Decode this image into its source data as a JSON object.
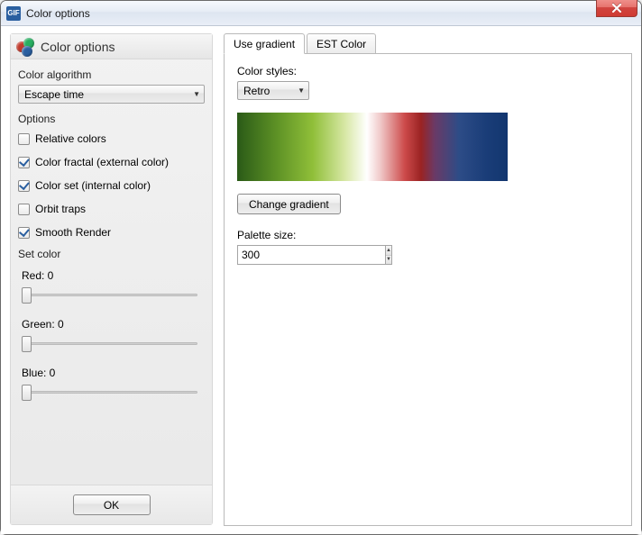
{
  "window": {
    "title": "Color options"
  },
  "left": {
    "heading": "Color options",
    "algorithm_label": "Color algorithm",
    "algorithm_value": "Escape time",
    "options_label": "Options",
    "checks": {
      "relative": "Relative colors",
      "fractal": "Color fractal (external color)",
      "set": "Color set (internal color)",
      "orbit": "Orbit traps",
      "smooth": "Smooth Render"
    },
    "set_color_label": "Set color",
    "red_label": "Red: 0",
    "green_label": "Green: 0",
    "blue_label": "Blue: 0",
    "ok_label": "OK"
  },
  "right": {
    "tabs": {
      "gradient": "Use gradient",
      "est": "EST Color"
    },
    "styles_label": "Color styles:",
    "styles_value": "Retro",
    "change_label": "Change gradient",
    "palette_label": "Palette size:",
    "palette_value": "300"
  }
}
